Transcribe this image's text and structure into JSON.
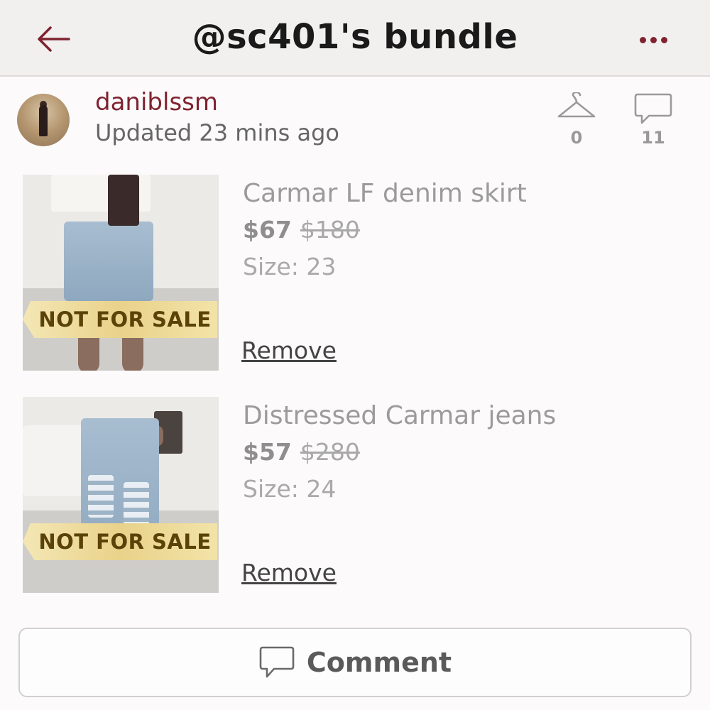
{
  "header": {
    "title": "@sc401's bundle",
    "back_icon": "back-arrow-icon",
    "more_icon": "more-dots-icon",
    "accent": "#7f2330"
  },
  "seller": {
    "username": "daniblssm",
    "updated": "Updated 23 mins ago",
    "likes_count": "0",
    "comments_count": "11"
  },
  "items": [
    {
      "title": "Carmar LF denim skirt",
      "price": "$67",
      "original_price": "$180",
      "size": "Size: 23",
      "banner": "NOT FOR SALE",
      "remove_label": "Remove"
    },
    {
      "title": "Distressed Carmar jeans",
      "price": "$57",
      "original_price": "$280",
      "size": "Size: 24",
      "banner": "NOT FOR SALE",
      "remove_label": "Remove"
    }
  ],
  "footer": {
    "comment_label": "Comment"
  }
}
